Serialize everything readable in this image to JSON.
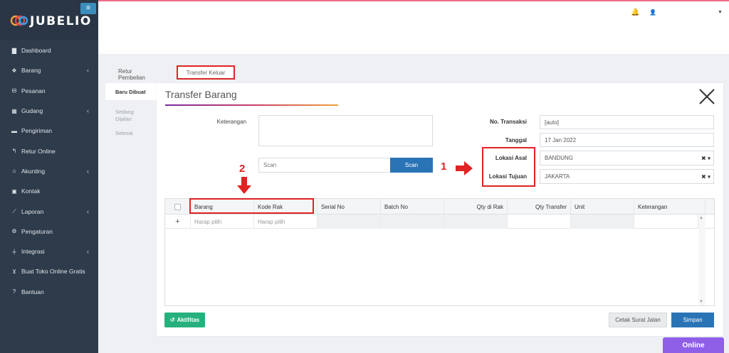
{
  "app": {
    "brand": "JUBELIO"
  },
  "sidebar": {
    "items": [
      {
        "label": "Dashboard",
        "icon": "chart-icon",
        "has_children": false
      },
      {
        "label": "Barang",
        "icon": "boxes-icon",
        "has_children": true
      },
      {
        "label": "Pesanan",
        "icon": "basket-icon",
        "has_children": false
      },
      {
        "label": "Gudang",
        "icon": "building-icon",
        "has_children": true
      },
      {
        "label": "Pengiriman",
        "icon": "truck-icon",
        "has_children": false
      },
      {
        "label": "Retur Online",
        "icon": "reply-icon",
        "has_children": false
      },
      {
        "label": "Akunting",
        "icon": "bank-icon",
        "has_children": true
      },
      {
        "label": "Kontak",
        "icon": "id-card-icon",
        "has_children": false
      },
      {
        "label": "Laporan",
        "icon": "line-chart-icon",
        "has_children": true
      },
      {
        "label": "Pengaturan",
        "icon": "cogs-icon",
        "has_children": false
      },
      {
        "label": "Integrasi",
        "icon": "plug-icon",
        "has_children": true
      },
      {
        "label": "Buat Toko Online Gratis",
        "icon": "cart-icon",
        "has_children": false
      },
      {
        "label": "Bantuan",
        "icon": "question-icon",
        "has_children": false
      }
    ]
  },
  "top_tabs": {
    "retur": "Retur Pembelian",
    "transfer": "Transfer Keluar"
  },
  "left_tabs": {
    "baru": "Baru Dibuat",
    "sedang_1": "Sedang",
    "sedang_2": "Dijalan",
    "selesai": "Selesai"
  },
  "form": {
    "title": "Transfer Barang",
    "keterangan_label": "Keterangan",
    "keterangan_value": "",
    "scan_placeholder": "Scan",
    "scan_button": "Scan",
    "no_transaksi_label": "No. Transaksi",
    "no_transaksi_value": "[auto]",
    "tanggal_label": "Tanggal",
    "tanggal_value": "17 Jan 2022",
    "lokasi_asal_label": "Lokasi Asal",
    "lokasi_asal_value": "BANDUNG",
    "lokasi_tujuan_label": "Lokasi Tujuan",
    "lokasi_tujuan_value": "JAKARTA"
  },
  "annotations": {
    "one": "1",
    "two": "2"
  },
  "grid": {
    "columns": [
      "Barang",
      "Kode Rak",
      "Serial No",
      "Batch No",
      "Qty di Rak",
      "Qty Transfer",
      "Unit",
      "Keterangan"
    ],
    "row": {
      "add": "+",
      "barang": "Harap pilih",
      "kode_rak": "Harap pilih"
    }
  },
  "footer": {
    "aktifitas": "Aktifitas",
    "cetak": "Cetak Surat Jalan",
    "simpan": "Simpan",
    "online": "Online"
  },
  "colors": {
    "sidebar": "#2e3b4a",
    "primary": "#2a74b6",
    "success": "#27b07d",
    "highlight": "#e02323",
    "chat": "#8f5fe8"
  }
}
